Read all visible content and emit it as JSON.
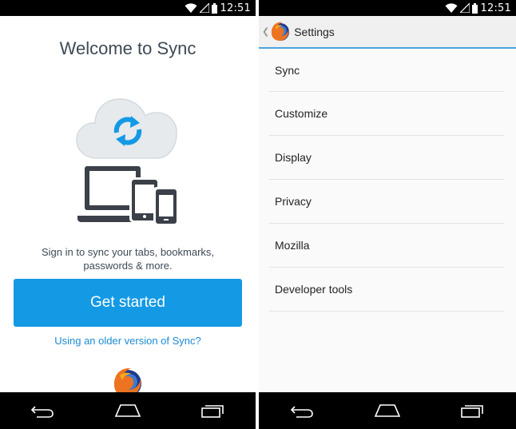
{
  "left": {
    "status": {
      "time": "12:51"
    },
    "title": "Welcome to Sync",
    "description_line1": "Sign in to sync your tabs, bookmarks,",
    "description_line2": "passwords & more.",
    "cta_label": "Get started",
    "older_link": "Using an older version of Sync?"
  },
  "right": {
    "status": {
      "time": "12:51"
    },
    "action_bar": {
      "title": "Settings"
    },
    "items": [
      {
        "label": "Sync"
      },
      {
        "label": "Customize"
      },
      {
        "label": "Display"
      },
      {
        "label": "Privacy"
      },
      {
        "label": "Mozilla"
      },
      {
        "label": "Developer tools"
      }
    ]
  },
  "icons": {
    "status": [
      "wifi-icon",
      "signal-icon",
      "battery-icon"
    ],
    "nav": [
      "back-icon",
      "home-icon",
      "recents-icon"
    ],
    "art": [
      "cloud-sync-icon",
      "laptop-icon",
      "tablet-icon",
      "phone-icon",
      "firefox-logo"
    ]
  },
  "colors": {
    "accent": "#1499e4",
    "link": "#1a8bd3",
    "action_bar_underline": "#4aa3df",
    "devices": "#3b4049",
    "cloud": "#e6eaed"
  }
}
